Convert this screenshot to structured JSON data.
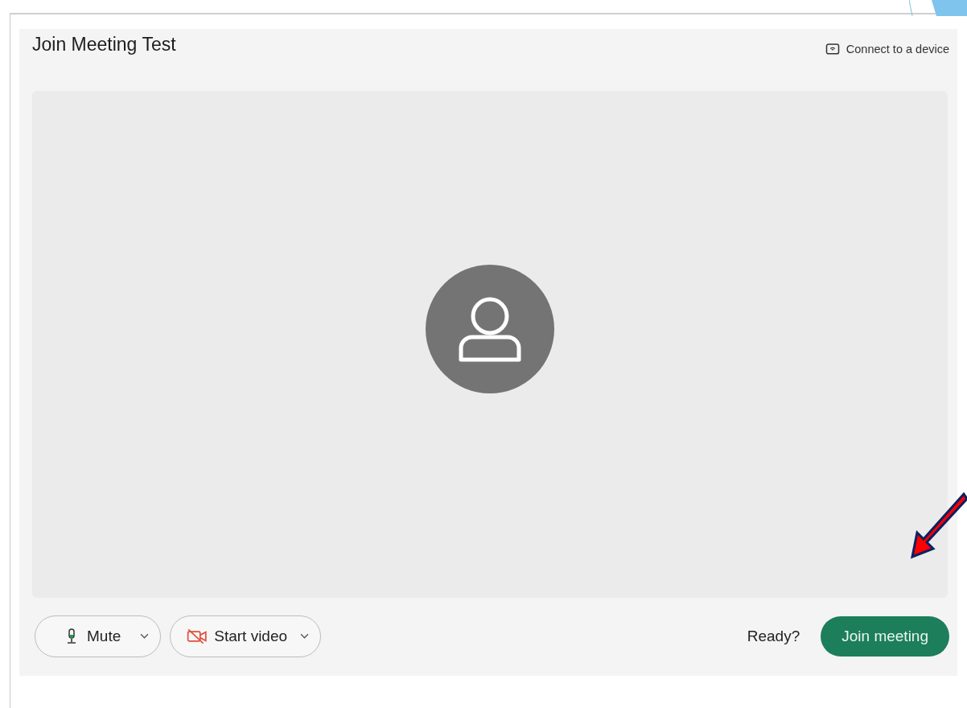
{
  "window": {
    "title": "Join Meeting Test"
  },
  "connect_device": {
    "label": "Connect to a device"
  },
  "controls": [
    {
      "kind": "audio",
      "label": "Mute"
    },
    {
      "kind": "video",
      "label": "Start video"
    }
  ],
  "status": "Ready?",
  "join_button": {
    "label": "Join meeting"
  }
}
